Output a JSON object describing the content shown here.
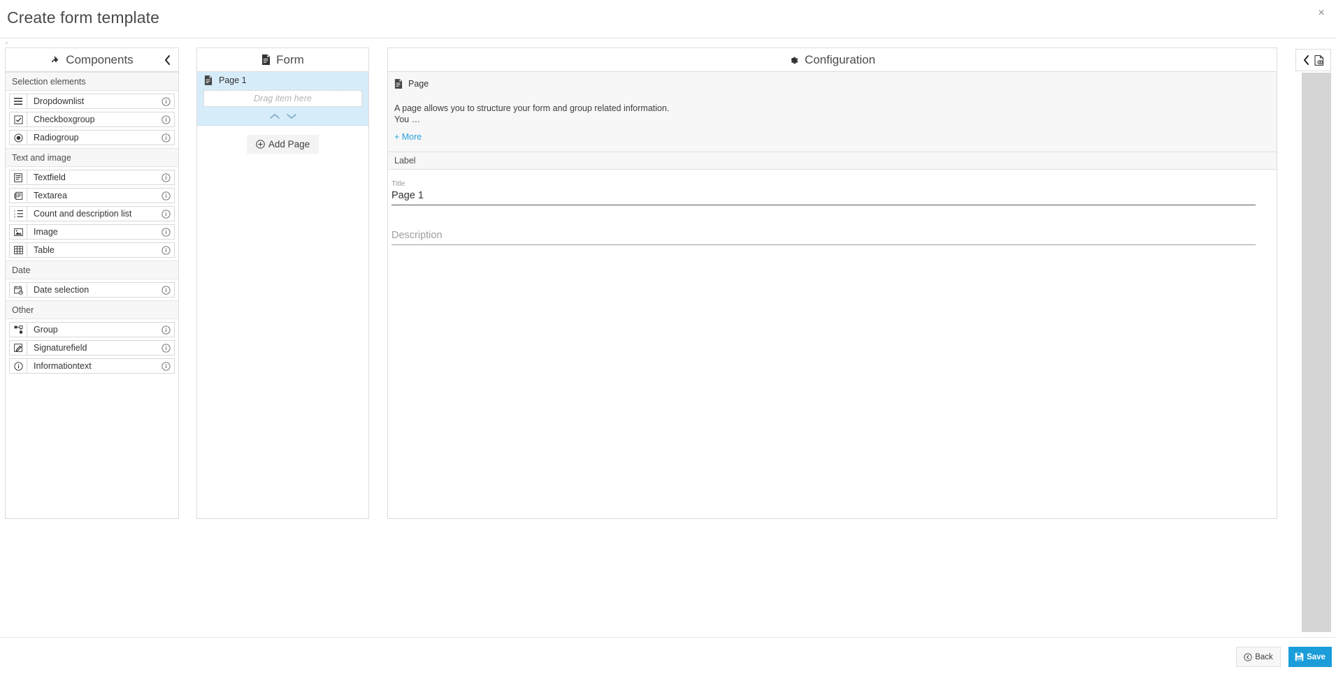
{
  "window": {
    "title": "Create form template",
    "close_label": "×"
  },
  "components_panel": {
    "header": "Components",
    "header_icon": "puzzle-piece-icon",
    "collapse_icon": "chevron-left-icon",
    "info_icon": "info-circle-icon",
    "sections": [
      {
        "title": "Selection elements",
        "items": [
          {
            "label": "Dropdownlist",
            "icon": "list-lines-icon"
          },
          {
            "label": "Checkboxgroup",
            "icon": "checkbox-checked-icon"
          },
          {
            "label": "Radiogroup",
            "icon": "radio-selected-icon"
          }
        ]
      },
      {
        "title": "Text and image",
        "items": [
          {
            "label": "Textfield",
            "icon": "text-field-icon"
          },
          {
            "label": "Textarea",
            "icon": "text-area-icon"
          },
          {
            "label": "Count and description list",
            "icon": "ordered-list-icon"
          },
          {
            "label": "Image",
            "icon": "image-icon"
          },
          {
            "label": "Table",
            "icon": "table-grid-icon"
          }
        ]
      },
      {
        "title": "Date",
        "items": [
          {
            "label": "Date selection",
            "icon": "calendar-clock-icon"
          }
        ]
      },
      {
        "title": "Other",
        "items": [
          {
            "label": "Group",
            "icon": "group-nodes-icon"
          },
          {
            "label": "Signaturefield",
            "icon": "signature-pen-icon"
          },
          {
            "label": "Informationtext",
            "icon": "info-circle-icon"
          }
        ]
      }
    ]
  },
  "form_panel": {
    "header": "Form",
    "header_icon": "document-icon",
    "page": {
      "label": "Page 1",
      "icon": "document-icon",
      "dropzone_text": "Drag item here",
      "move_up_icon": "chevron-up-icon",
      "move_down_icon": "chevron-down-icon"
    },
    "add_page_label": "Add Page",
    "add_page_icon": "plus-circle-icon"
  },
  "config_panel": {
    "header": "Configuration",
    "header_icon": "gear-icon",
    "type_label": "Page",
    "type_icon": "document-icon",
    "description": "A page allows you to structure your form and group related information.\nYou …",
    "more_label": "+ More",
    "section_label": "Label",
    "fields": {
      "title_label": "Title",
      "title_value": "Page 1",
      "description_placeholder": "Description",
      "description_value": ""
    }
  },
  "right_rail": {
    "collapse_icon": "chevron-left-icon",
    "preview_icon": "document-preview-eye-icon"
  },
  "footer": {
    "back_label": "Back",
    "back_icon": "circle-arrow-left-icon",
    "save_label": "Save",
    "save_icon": "floppy-disk-icon"
  },
  "colors": {
    "accent": "#1b9dd9",
    "link": "#29a3dd",
    "selected_page_bg": "#d6ecf9",
    "panel_border": "#dcdcdc",
    "group_header_bg": "#f7f7f7"
  }
}
